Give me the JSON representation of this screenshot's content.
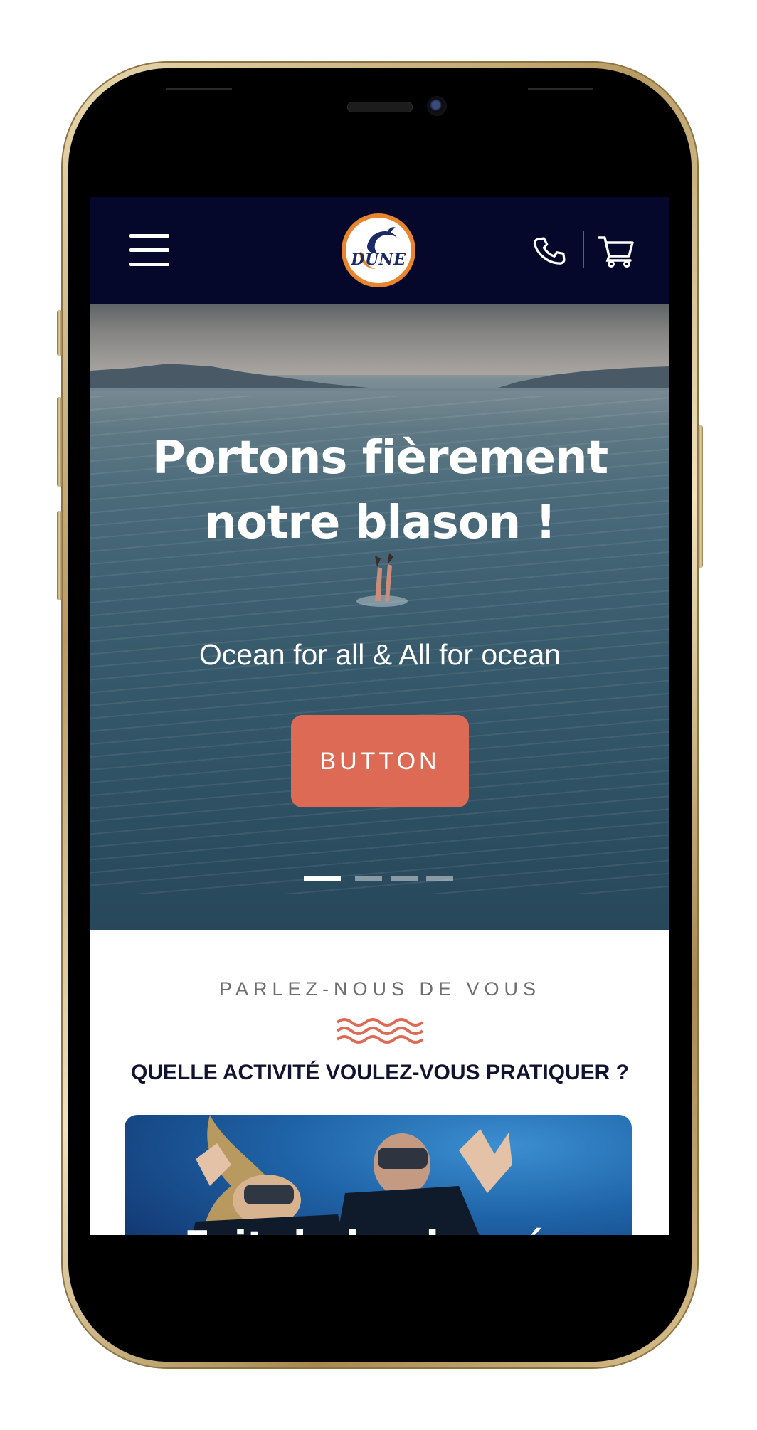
{
  "navbar": {
    "logo_text": "DUNE",
    "menu_icon": "hamburger-menu-icon",
    "phone_icon": "phone-icon",
    "cart_icon": "cart-icon"
  },
  "hero": {
    "title_line1": "Portons fièrement",
    "title_line2": "notre blason !",
    "subtitle": "Ocean for all & All for ocean",
    "button_label": "BUTTON",
    "slides_count": 4,
    "active_slide": 1
  },
  "section": {
    "eyebrow": "PARLEZ-NOUS DE VOUS",
    "heading": "QUELLE ACTIVITÉ VOULEZ-VOUS PRATIQUER ?",
    "card_title": "Fait de la plongée"
  },
  "colors": {
    "navbar_bg": "#05082a",
    "accent": "#dd6a55",
    "logo_ring": "#e8842e",
    "heading_text": "#11132f"
  }
}
